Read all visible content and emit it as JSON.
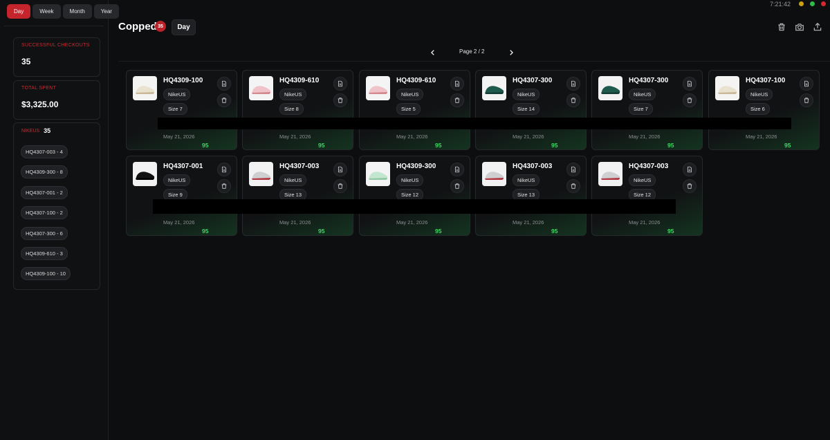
{
  "sidebar": {
    "range_tabs": [
      {
        "label": "Day",
        "active": true
      },
      {
        "label": "Week",
        "active": false
      },
      {
        "label": "Month",
        "active": false
      },
      {
        "label": "Year",
        "active": false
      }
    ],
    "successful_checkouts": {
      "label": "SUCCESSFUL CHECKOUTS",
      "value": "35"
    },
    "total_spent": {
      "label": "TOTAL SPENT",
      "value": "$3,325.00"
    },
    "store": {
      "name": "NIKEUS",
      "count": "35",
      "skus": [
        "HQ4307-003 - 4",
        "HQ4309-300 - 8",
        "HQ4307-001 - 2",
        "HQ4307-100 - 2",
        "HQ4307-300 - 6",
        "HQ4309-610 - 3",
        "HQ4309-100 - 10"
      ]
    }
  },
  "header": {
    "title": "Copped",
    "count": "35",
    "range_label": "Day",
    "icons": [
      "trash-icon",
      "camera-icon",
      "upload-icon"
    ]
  },
  "window": {
    "clock": "7:21:42",
    "dots": [
      "#c9a20e",
      "#2dbd4b",
      "#d8282f"
    ]
  },
  "pagination": {
    "text": "Page 2 / 2"
  },
  "cards": [
    {
      "sku": "HQ4309-100",
      "store": "NikeUS",
      "size": "Size 7",
      "date": "May 21, 2026",
      "price": "95",
      "shoe": "cream"
    },
    {
      "sku": "HQ4309-610",
      "store": "NikeUS",
      "size": "Size 8",
      "date": "May 21, 2026",
      "price": "95",
      "shoe": "pink"
    },
    {
      "sku": "HQ4309-610",
      "store": "NikeUS",
      "size": "Size 5",
      "date": "May 21, 2026",
      "price": "95",
      "shoe": "pink"
    },
    {
      "sku": "HQ4307-300",
      "store": "NikeUS",
      "size": "Size 14",
      "date": "May 21, 2026",
      "price": "95",
      "shoe": "teal"
    },
    {
      "sku": "HQ4307-300",
      "store": "NikeUS",
      "size": "Size 7",
      "date": "May 21, 2026",
      "price": "95",
      "shoe": "teal"
    },
    {
      "sku": "HQ4307-100",
      "store": "NikeUS",
      "size": "Size 6",
      "date": "May 21, 2026",
      "price": "95",
      "shoe": "cream"
    },
    {
      "sku": "HQ4307-001",
      "store": "NikeUS",
      "size": "Size 9",
      "date": "May 21, 2026",
      "price": "95",
      "shoe": "black"
    },
    {
      "sku": "HQ4307-003",
      "store": "NikeUS",
      "size": "Size 13",
      "date": "May 21, 2026",
      "price": "95",
      "shoe": "grey-red"
    },
    {
      "sku": "HQ4309-300",
      "store": "NikeUS",
      "size": "Size 12",
      "date": "May 21, 2026",
      "price": "95",
      "shoe": "mint"
    },
    {
      "sku": "HQ4307-003",
      "store": "NikeUS",
      "size": "Size 13",
      "date": "May 21, 2026",
      "price": "95",
      "shoe": "grey-red"
    },
    {
      "sku": "HQ4307-003",
      "store": "NikeUS",
      "size": "Size 12",
      "date": "May 21, 2026",
      "price": "95",
      "shoe": "grey-red"
    }
  ]
}
